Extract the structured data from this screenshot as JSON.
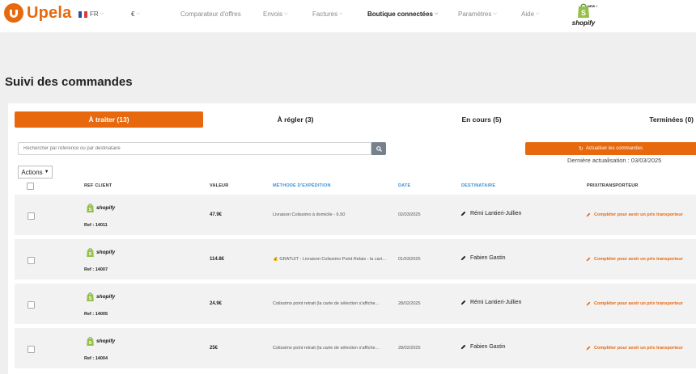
{
  "brand": {
    "name": "Upela"
  },
  "header": {
    "lang": "FR",
    "currency": "€",
    "nav": [
      {
        "label": "Comparateur d'offres",
        "chevron": false
      },
      {
        "label": "Envois",
        "chevron": true
      },
      {
        "label": "Factures",
        "chevron": true
      },
      {
        "label": "Boutique connectées",
        "chevron": true
      },
      {
        "label": "Paramètres",
        "chevron": true
      },
      {
        "label": "Aide",
        "chevron": true
      }
    ],
    "shopify_badge": "NEW !",
    "shopify_label": "shopify"
  },
  "page": {
    "title": "Suivi des commandes"
  },
  "tabs": [
    {
      "label": "À traiter (13)",
      "active": true
    },
    {
      "label": "À régler (3)",
      "active": false
    },
    {
      "label": "En cours (5)",
      "active": false
    },
    {
      "label": "Terminées (0)",
      "active": false
    }
  ],
  "search": {
    "placeholder": "Rechercher par référence ou par destinataire"
  },
  "refresh": {
    "label": "Actualiser les commandes"
  },
  "last_update": "Dernière actualisation : 03/03/2025",
  "actions": {
    "label": "Actions"
  },
  "table": {
    "headers": [
      "REF CLIENT",
      "VALEUR",
      "MÉTHODE D'EXPÉDITION",
      "DATE",
      "DESTINATAIRE",
      "PRIX/TRANSPORTEUR"
    ],
    "rows": [
      {
        "shop": "shopify",
        "ref": "Ref : 14011",
        "value": "47.9€",
        "method": "Livraison Colissimo à domicile - 6.50",
        "date": "02/03/2025",
        "recipient": "Rémi Lantieri-Jullien",
        "price": "Compléter pour avoir un prix transporteur"
      },
      {
        "shop": "shopify",
        "ref": "Ref : 14007",
        "value": "114.8€",
        "method": "💰 GRATUIT - Livraison Colissimo Point Relais - la carte...",
        "date": "01/03/2025",
        "recipient": "Fabien Gastin",
        "price": "Compléter pour avoir un prix transporteur"
      },
      {
        "shop": "shopify",
        "ref": "Ref : 14005",
        "value": "24.9€",
        "method": "Colissimo point retrait (la carte de sélection s'affiche...",
        "date": "28/02/2025",
        "recipient": "Rémi Lantieri-Jullien",
        "price": "Compléter pour avoir un prix transporteur"
      },
      {
        "shop": "shopify",
        "ref": "Ref : 14004",
        "value": "25€",
        "method": "Colissimo point retrait (la carte de sélection s'affiche...",
        "date": "28/02/2025",
        "recipient": "Fabien Gastin",
        "price": "Compléter pour avoir un prix transporteur"
      }
    ]
  },
  "colors": {
    "accent": "#e8680e",
    "header_blue": "#3a8fd8",
    "row_bg": "#f2f2f2"
  },
  "icons": {
    "search": "search-icon",
    "refresh": "refresh-icon",
    "edit": "pencil-icon",
    "shop": "shopify-bag-icon"
  }
}
